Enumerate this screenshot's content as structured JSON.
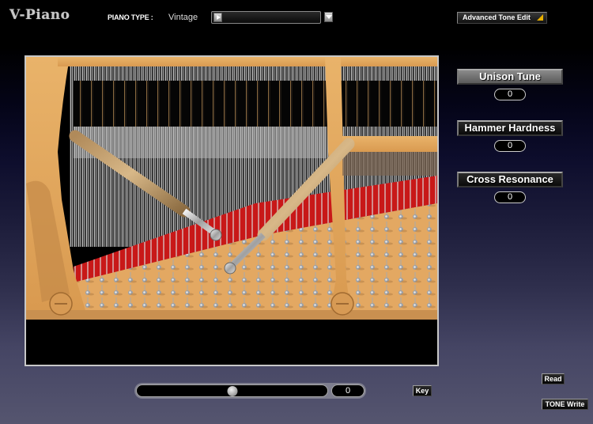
{
  "header": {
    "logo": "V-Piano",
    "piano_type_label": "PIANO TYPE :",
    "piano_type_value": "Vintage",
    "type_select_value": "",
    "advanced_tone_edit": "Advanced Tone Edit"
  },
  "params": [
    {
      "label": "Unison Tune",
      "value": "0"
    },
    {
      "label": "Hammer Hardness",
      "value": "0"
    },
    {
      "label": "Cross Resonance",
      "value": "0"
    }
  ],
  "slider": {
    "value": "0",
    "position_fraction": 0.5
  },
  "buttons": {
    "key": "Key",
    "read": "Read",
    "tone_write": "TONE Write"
  },
  "colors": {
    "accent_triangle": "#e8b000",
    "piano_frame": "#e0a860",
    "felt_red": "#c81818"
  }
}
